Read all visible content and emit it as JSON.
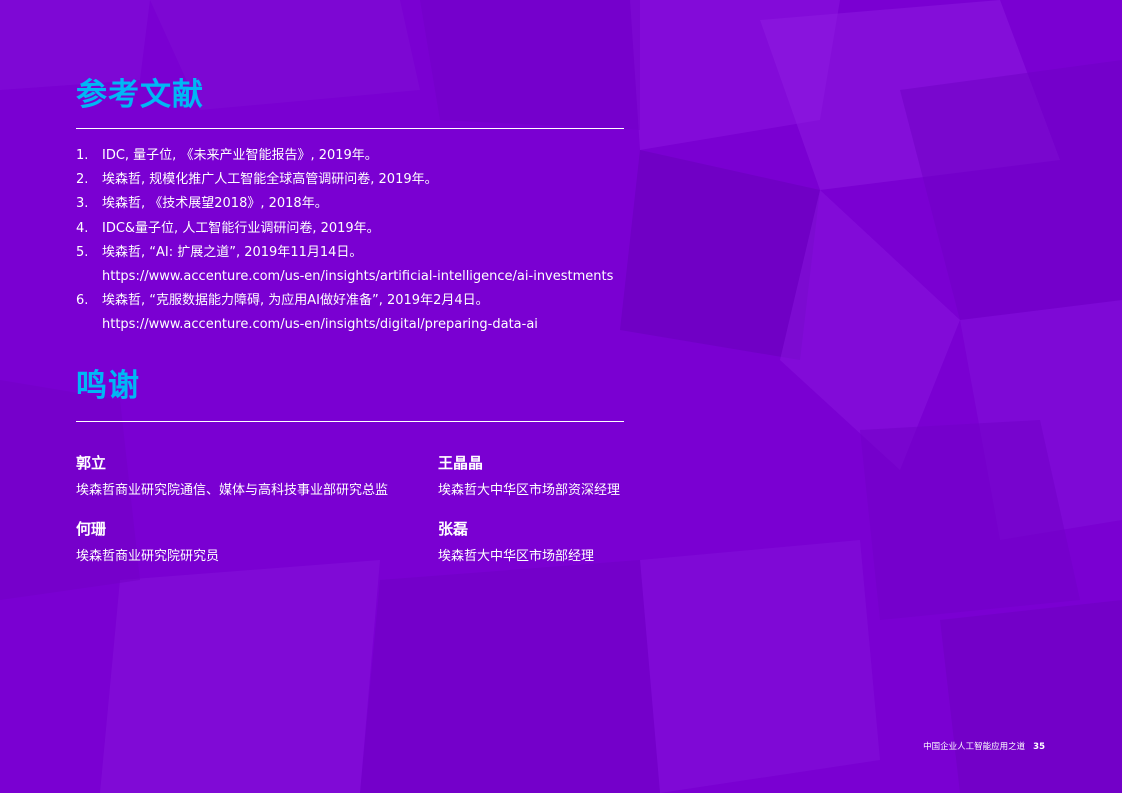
{
  "references": {
    "title": "参考文献",
    "items": [
      {
        "num": "1.",
        "text": "IDC, 量子位, 《未来产业智能报告》, 2019年。",
        "url": ""
      },
      {
        "num": "2.",
        "text": "埃森哲, 规模化推广人工智能全球高管调研问卷, 2019年。",
        "url": ""
      },
      {
        "num": "3.",
        "text": "埃森哲, 《技术展望2018》, 2018年。",
        "url": ""
      },
      {
        "num": "4.",
        "text": "IDC&量子位, 人工智能行业调研问卷, 2019年。",
        "url": ""
      },
      {
        "num": "5.",
        "text": "埃森哲, “AI: 扩展之道”, 2019年11月14日。",
        "url": "https://www.accenture.com/us-en/insights/artificial-intelligence/ai-investments"
      },
      {
        "num": "6.",
        "text": "埃森哲, “克服数据能力障碍, 为应用AI做好准备”, 2019年2月4日。",
        "url": "https://www.accenture.com/us-en/insights/digital/preparing-data-ai"
      }
    ]
  },
  "acknowledgements": {
    "title": "鸣谢",
    "people": [
      {
        "name": "郭立",
        "title": "埃森哲商业研究院通信、媒体与高科技事业部研究总监"
      },
      {
        "name": "王晶晶",
        "title": "埃森哲大中华区市场部资深经理"
      },
      {
        "name": "何珊",
        "title": "埃森哲商业研究院研究员"
      },
      {
        "name": "张磊",
        "title": "埃森哲大中华区市场部经理"
      }
    ]
  },
  "footer": {
    "doc_title": "中国企业人工智能应用之道",
    "page_number": "35"
  },
  "colors": {
    "background": "#7a00d2",
    "heading": "#00b7f5",
    "text": "#ffffff"
  }
}
